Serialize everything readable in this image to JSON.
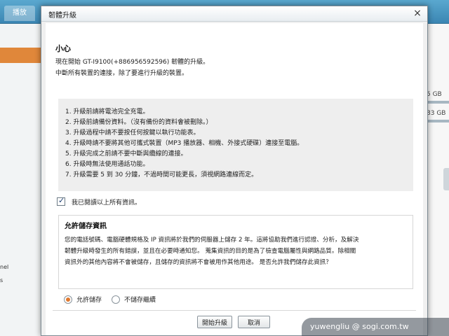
{
  "background_app": {
    "tabs": [
      "播放",
      "檢視"
    ],
    "right_sizes": [
      "5 GB",
      "83 GB"
    ],
    "left_texts": [
      "nel",
      "s"
    ],
    "accent_color": "#e0873a"
  },
  "dialog": {
    "title": "韌體升級",
    "close_symbol": "×",
    "warning_title": "小心",
    "intro_lines": [
      "現在開始 GT-I9100(+886956592596) 韌體的升級。",
      "中斷所有裝置的連接，除了要進行升級的裝置。"
    ],
    "steps": [
      "1. 升級前請將電池完全充電。",
      "2. 升級前請備份資料。（沒有備份的資料會被刪除。）",
      "3. 升級過程中請不要按任何按鍵以執行功能表。",
      "4. 升級時請不要將其他可攜式裝置（MP3 播放器、相機、外接式硬碟）連接至電腦。",
      "5. 升級完成之前請不要中斷與纜線的連接。",
      "6. 升級時無法使用通話功能。",
      "7. 升級需要 5 到 30 分鐘，不過時間可能更長，須視網路連線而定。"
    ],
    "agree_label": "我已閱讀以上所有資訊。",
    "agree_checked": true,
    "privacy": {
      "title": "允許儲存資訊",
      "lines": [
        "您的電話號碼、電腦硬體規格及 IP 資訊將於我們的伺服器上儲存 2 年。這將協助我們進行認證、分析，及解決",
        "韌體升級時發生的所有錯誤，並且在必要時通知您。 蒐集資訊的目的是為了檢查電腦屬性與網路品質。除相關",
        "資訊外的其他內容將不會被儲存，且儲存的資訊將不會被用作其他用途。 是否允許我們儲存此資訊？"
      ]
    },
    "radio_allow": "允許儲存",
    "radio_deny": "不儲存繼續",
    "selected_radio": "allow",
    "buttons": {
      "start": "開始升級",
      "cancel": "取消"
    }
  },
  "watermark": "yuwengliu   @ sogi.com.tw"
}
